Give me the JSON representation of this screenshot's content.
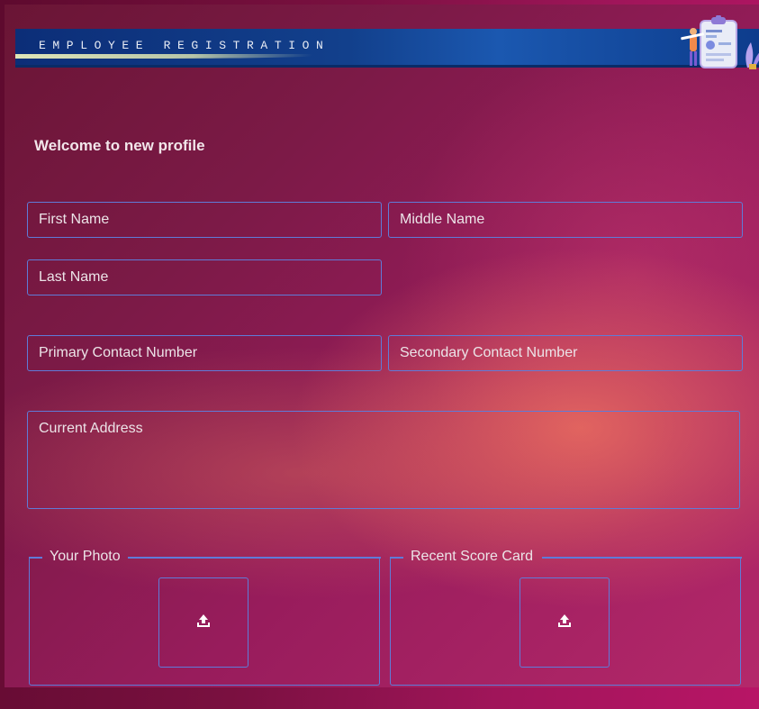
{
  "header": {
    "title": "EMPLOYEE REGISTRATION",
    "illustration_icon": "clipboard-illustration-icon"
  },
  "form": {
    "welcome": "Welcome to new profile",
    "first_name_placeholder": "First Name",
    "middle_name_placeholder": "Middle Name",
    "last_name_placeholder": "Last Name",
    "primary_contact_placeholder": "Primary Contact Number",
    "secondary_contact_placeholder": "Secondary Contact Number",
    "address_placeholder": "Current Address",
    "photo_label": "Your Photo",
    "score_card_label": "Recent Score Card",
    "upload_icon": "upload-icon"
  },
  "colors": {
    "field_border": "#5f7bd8",
    "banner": "#12408c",
    "background": "#7c1a47"
  }
}
